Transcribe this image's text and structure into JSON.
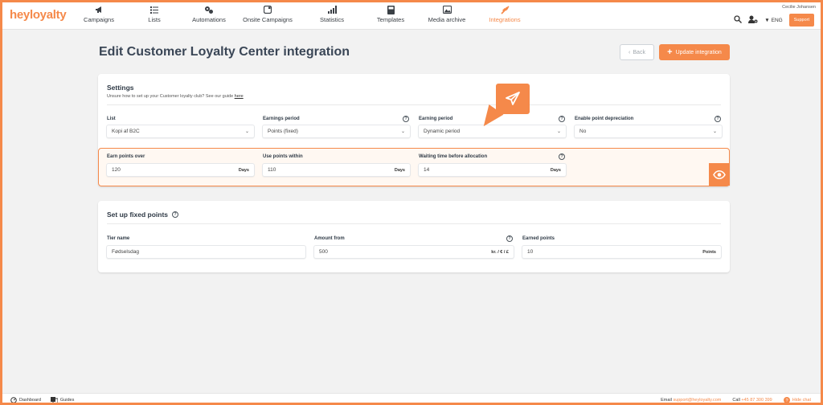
{
  "brand": {
    "logo_text": "heyloyalty",
    "accent": "#f5894a"
  },
  "nav": {
    "items": [
      {
        "label": "Campaigns",
        "icon": "megaphone-icon"
      },
      {
        "label": "Lists",
        "icon": "list-icon"
      },
      {
        "label": "Automations",
        "icon": "automation-icon"
      },
      {
        "label": "Onsite Campaigns",
        "icon": "onsite-icon"
      },
      {
        "label": "Statistics",
        "icon": "bar-chart-icon"
      },
      {
        "label": "Templates",
        "icon": "template-icon"
      },
      {
        "label": "Media archive",
        "icon": "image-icon"
      },
      {
        "label": "Integrations",
        "icon": "integrations-icon",
        "active": true
      }
    ]
  },
  "header_tools": {
    "user_name": "Cecilie Johansen",
    "language": "ENG",
    "support_label": "Support"
  },
  "page": {
    "title": "Edit Customer Loyalty Center integration",
    "back_label": "Back",
    "update_label": "Update integration"
  },
  "settings": {
    "title": "Settings",
    "guide_text": "Unsure how to set up your Customer loyalty club? See our guide",
    "guide_link": "here",
    "fields": {
      "list": {
        "label": "List",
        "value": "Kopi af B2C"
      },
      "earnings_period": {
        "label": "Earnings period",
        "value": "Points (fixed)"
      },
      "earning_period": {
        "label": "Earning period",
        "value": "Dynamic period"
      },
      "depreciation": {
        "label": "Enable point depreciation",
        "value": "No"
      },
      "earn_over": {
        "label": "Earn points over",
        "value": "120",
        "unit": "Days"
      },
      "use_within": {
        "label": "Use points within",
        "value": "110",
        "unit": "Days"
      },
      "waiting": {
        "label": "Waiting time before allocation",
        "value": "14",
        "unit": "Days"
      }
    }
  },
  "fixed_points": {
    "title": "Set up fixed points",
    "tier_label": "Tier name",
    "tier_value": "Fødselsdag",
    "amount_label": "Amount from",
    "amount_value": "500",
    "amount_unit": "kr. / € / £",
    "points_label": "Earned points",
    "points_value": "10",
    "points_unit": "Points"
  },
  "footer": {
    "dashboard": "Dashboard",
    "guides": "Guides",
    "email_label": "Email",
    "email": "support@heyloyalty.com",
    "call_label": "Call",
    "phone": "+45 87 300 399",
    "hide_chat": "Hide chat"
  }
}
